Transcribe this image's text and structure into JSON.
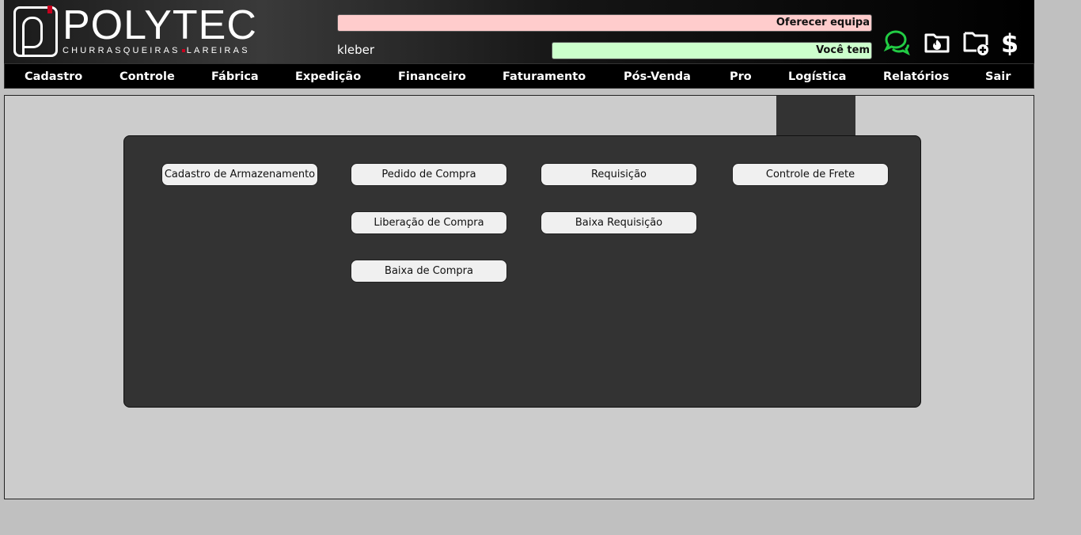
{
  "header": {
    "logo": {
      "word": "POLYTEC",
      "tagline_left": "CHURRASQUEIRAS",
      "tagline_right": "LAREIRAS"
    },
    "notice_pink": "Oferecer equipa",
    "notice_green": "Você tem",
    "username": "kleber",
    "icons": [
      "chat-icon",
      "fire-folder-icon",
      "folder-add-icon",
      "dollar-icon"
    ],
    "chat_icon_color": "#22cc44"
  },
  "nav": {
    "items": [
      {
        "label": "Cadastro"
      },
      {
        "label": "Controle"
      },
      {
        "label": "Fábrica"
      },
      {
        "label": "Expedição"
      },
      {
        "label": "Financeiro"
      },
      {
        "label": "Faturamento"
      },
      {
        "label": "Pós-Venda"
      },
      {
        "label": "Pro"
      },
      {
        "label": "Logística"
      },
      {
        "label": "Relatórios"
      },
      {
        "label": "Sair"
      }
    ]
  },
  "panel": {
    "buttons": [
      {
        "label": "Cadastro de Armazenamento"
      },
      {
        "label": "Pedido de Compra"
      },
      {
        "label": "Requisição"
      },
      {
        "label": "Controle de Frete"
      },
      {
        "label": "Liberação de Compra"
      },
      {
        "label": "Baixa Requisição"
      },
      {
        "label": "Baixa de Compra"
      }
    ]
  }
}
